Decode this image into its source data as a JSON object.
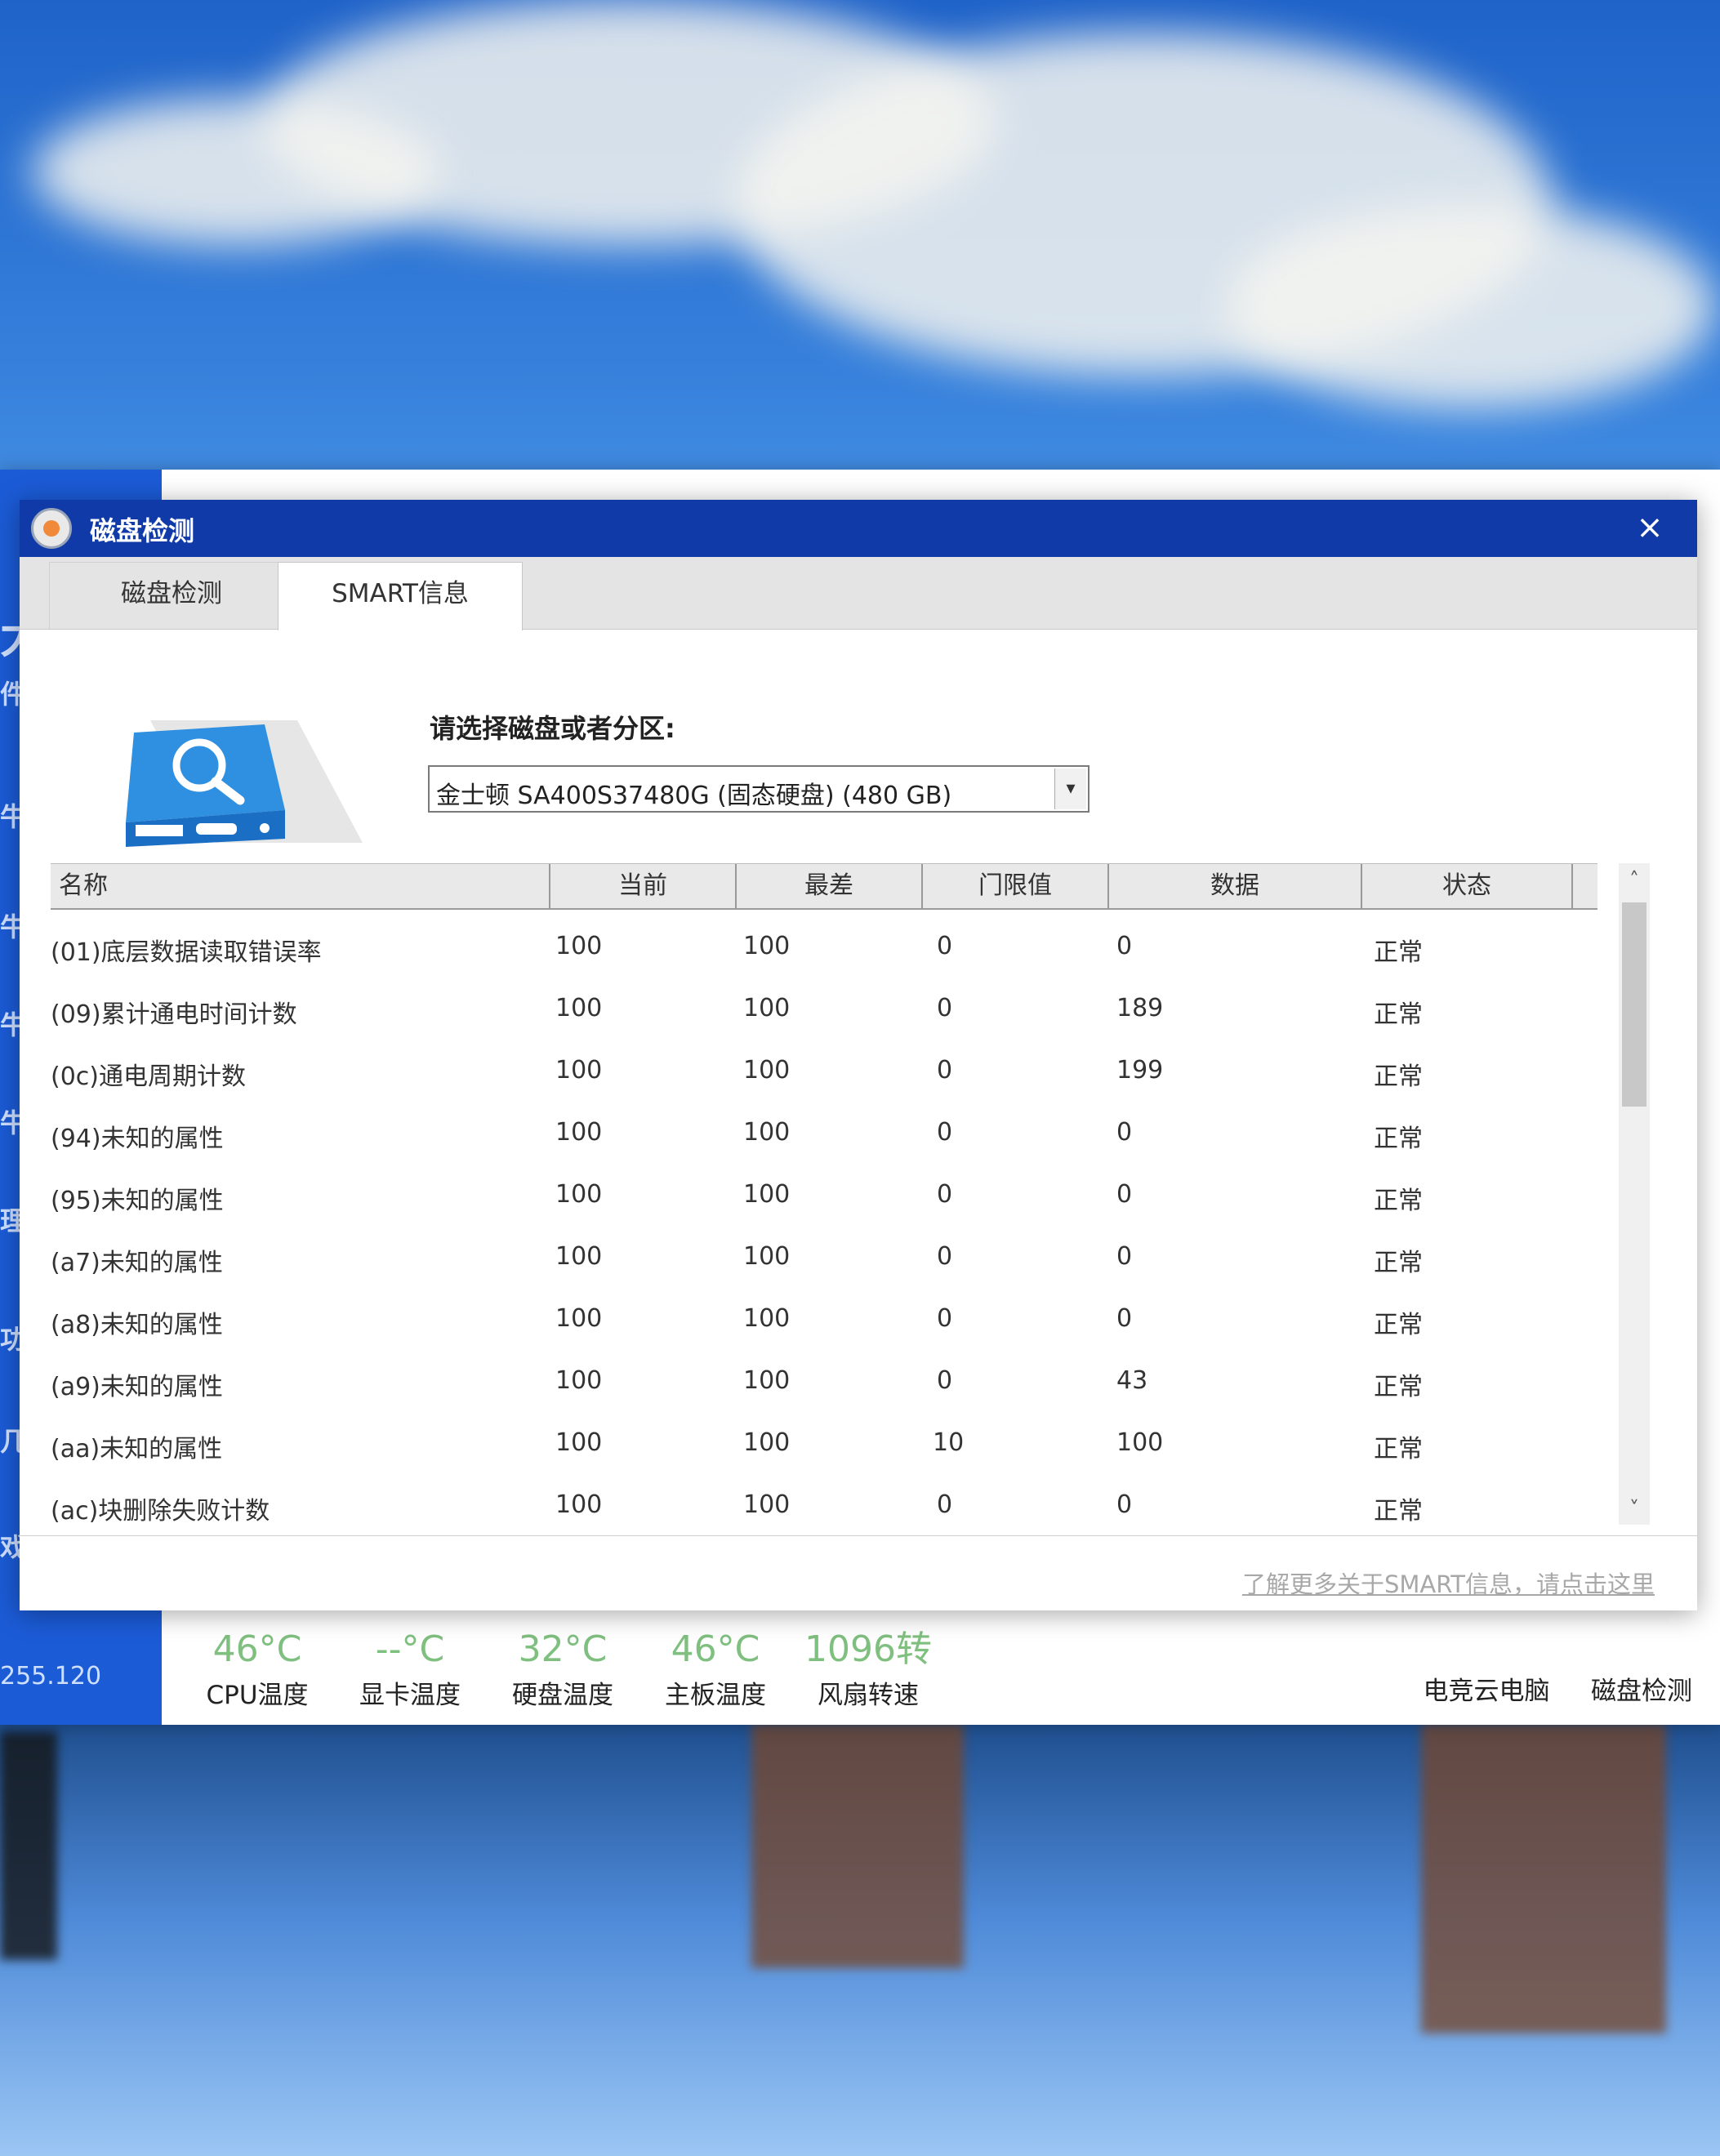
{
  "dialog": {
    "title": "磁盘检测",
    "close_label": "×",
    "tabs": [
      {
        "label": "磁盘检测",
        "active": false
      },
      {
        "label": "SMART信息",
        "active": true
      }
    ],
    "select_label": "请选择磁盘或者分区:",
    "selected_disk": "金士顿  SA400S37480G (固态硬盘)  (480 GB)",
    "dropdown_arrow": "▾",
    "columns": [
      "名称",
      "当前",
      "最差",
      "门限值",
      "数据",
      "状态"
    ],
    "rows": [
      {
        "name": "(01)底层数据读取错误率",
        "current": "100",
        "worst": "100",
        "threshold": "0",
        "data": "0",
        "status": "正常"
      },
      {
        "name": "(09)累计通电时间计数",
        "current": "100",
        "worst": "100",
        "threshold": "0",
        "data": "189",
        "status": "正常"
      },
      {
        "name": "(0c)通电周期计数",
        "current": "100",
        "worst": "100",
        "threshold": "0",
        "data": "199",
        "status": "正常"
      },
      {
        "name": "(94)未知的属性",
        "current": "100",
        "worst": "100",
        "threshold": "0",
        "data": "0",
        "status": "正常"
      },
      {
        "name": "(95)未知的属性",
        "current": "100",
        "worst": "100",
        "threshold": "0",
        "data": "0",
        "status": "正常"
      },
      {
        "name": "(a7)未知的属性",
        "current": "100",
        "worst": "100",
        "threshold": "0",
        "data": "0",
        "status": "正常"
      },
      {
        "name": "(a8)未知的属性",
        "current": "100",
        "worst": "100",
        "threshold": "0",
        "data": "0",
        "status": "正常"
      },
      {
        "name": "(a9)未知的属性",
        "current": "100",
        "worst": "100",
        "threshold": "0",
        "data": "43",
        "status": "正常"
      },
      {
        "name": "(aa)未知的属性",
        "current": "100",
        "worst": "100",
        "threshold": "10",
        "data": "100",
        "status": "正常"
      },
      {
        "name": "(ac)块删除失败计数",
        "current": "100",
        "worst": "100",
        "threshold": "0",
        "data": "0",
        "status": "正常"
      }
    ],
    "scroll_up": "˄",
    "scroll_down": "˅",
    "footer_link": "了解更多关于SMART信息，请点击这里"
  },
  "background_app": {
    "ip_fragment": "255.120",
    "sidebar_fragments": [
      "大",
      "件",
      "牛",
      "牛",
      "牛",
      "牛",
      "理",
      "功",
      "几",
      "戏"
    ],
    "stats": [
      {
        "value": "46°C",
        "label": "CPU温度"
      },
      {
        "value": "--°C",
        "label": "显卡温度"
      },
      {
        "value": "32°C",
        "label": "硬盘温度"
      },
      {
        "value": "46°C",
        "label": "主板温度"
      },
      {
        "value": "1096转",
        "label": "风扇转速"
      }
    ],
    "quick_items": [
      {
        "label": "电竞云电脑",
        "icon": "monitor-icon"
      },
      {
        "label": "磁盘检测",
        "icon": "disk-icon"
      }
    ]
  },
  "colors": {
    "titlebar": "#0f3aa8",
    "sidebar": "#1b5bd6",
    "stat_value": "#7fbf7f"
  }
}
